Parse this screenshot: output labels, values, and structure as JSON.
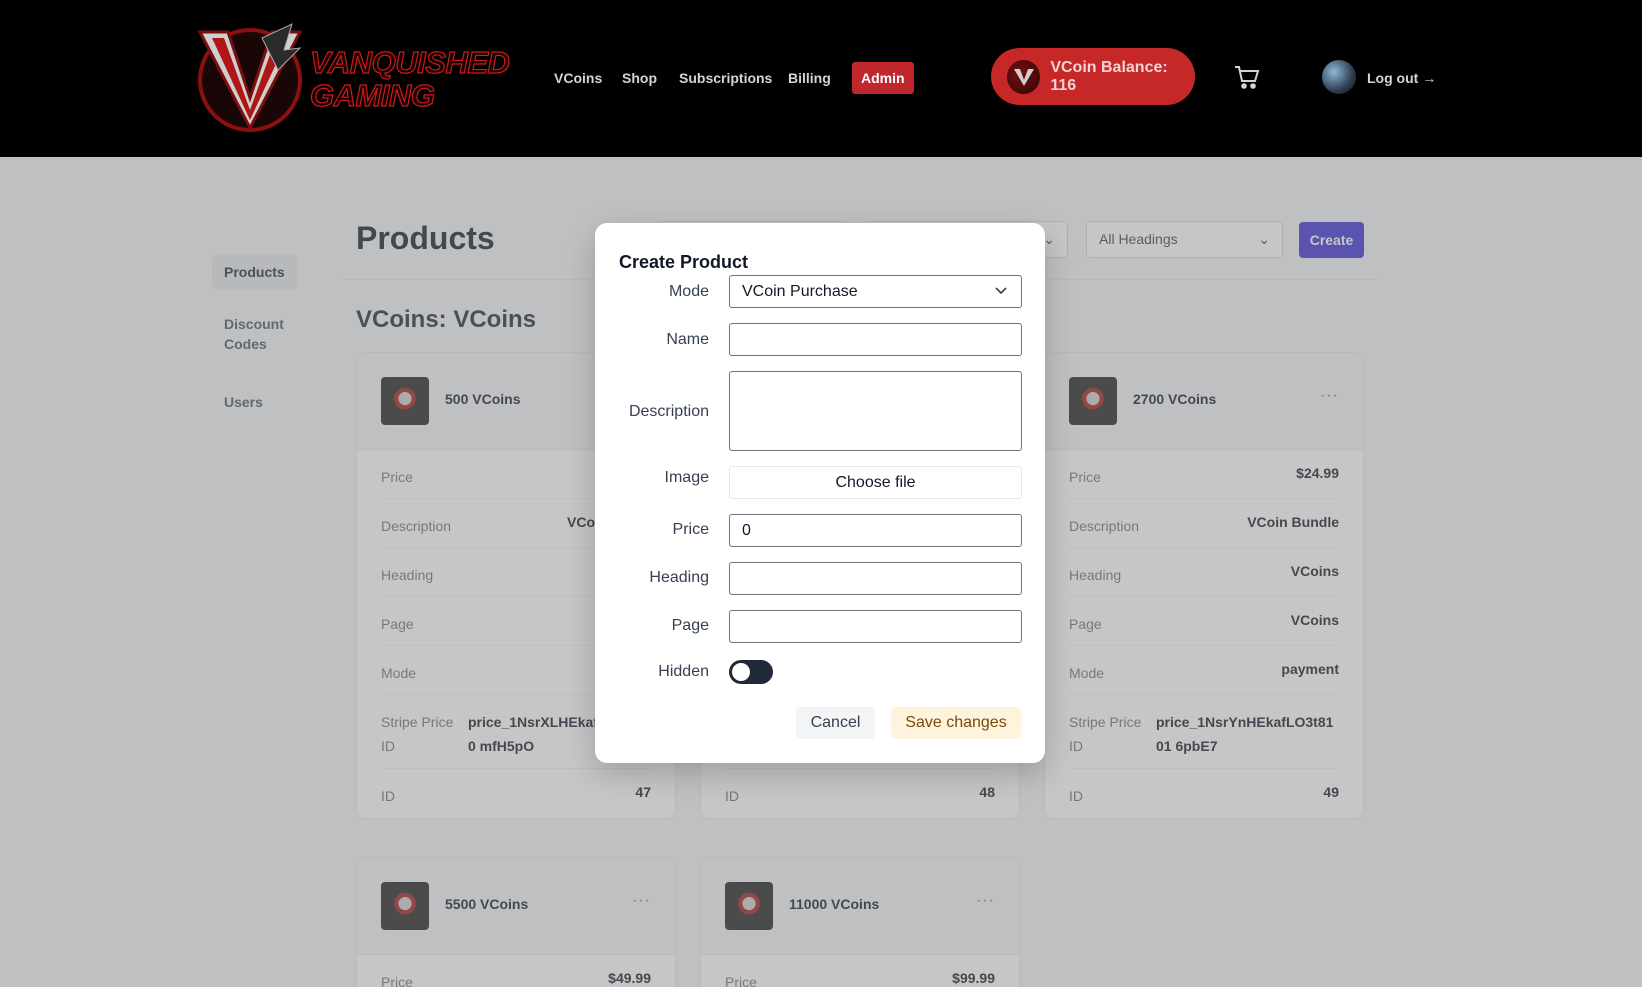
{
  "header": {
    "logo_text": "VANQUISHED GAMING",
    "nav": [
      "VCoins",
      "Shop",
      "Subscriptions",
      "Billing",
      "Admin"
    ],
    "balance": "VCoin Balance: 116",
    "logout": "Log out →"
  },
  "sidebar": {
    "items": [
      "Products",
      "Discount Codes",
      "Users"
    ]
  },
  "toolbar": {
    "title": "Products",
    "filter_headings": "All Headings",
    "create": "Create"
  },
  "section": {
    "title": "VCoins: VCoins"
  },
  "cards": [
    {
      "name": "500 VCoins",
      "labels": {
        "price": "Price",
        "description": "Description",
        "heading": "Heading",
        "page": "Page",
        "mode": "Mode",
        "stripe": "Stripe Price ID",
        "id": "ID"
      },
      "description": "VCoi",
      "stripe": "price_1NsrXLHEkafL0 mfH5pO",
      "id": "47"
    },
    {
      "id": "48",
      "labels": {
        "id": "ID"
      }
    },
    {
      "name": "2700 VCoins",
      "labels": {
        "price": "Price",
        "description": "Description",
        "heading": "Heading",
        "page": "Page",
        "mode": "Mode",
        "stripe": "Stripe Price ID",
        "id": "ID"
      },
      "price": "$24.99",
      "description": "VCoin Bundle",
      "heading": "VCoins",
      "page": "VCoins",
      "mode": "payment",
      "stripe": "price_1NsrYnHEkafLO3t8101 6pbE7",
      "id": "49"
    },
    {
      "name": "5500 VCoins",
      "labels": {
        "price": "Price"
      },
      "price": "$49.99"
    },
    {
      "name": "11000 VCoins",
      "labels": {
        "price": "Price"
      },
      "price": "$99.99"
    }
  ],
  "modal": {
    "title": "Create Product",
    "labels": {
      "mode": "Mode",
      "name": "Name",
      "description": "Description",
      "image": "Image",
      "price": "Price",
      "heading": "Heading",
      "page": "Page",
      "hidden": "Hidden"
    },
    "mode_value": "VCoin Purchase",
    "name_value": "",
    "description_value": "",
    "image_button": "Choose file",
    "price_value": "0",
    "heading_value": "",
    "page_value": "",
    "hidden": false,
    "cancel": "Cancel",
    "save": "Save changes"
  }
}
